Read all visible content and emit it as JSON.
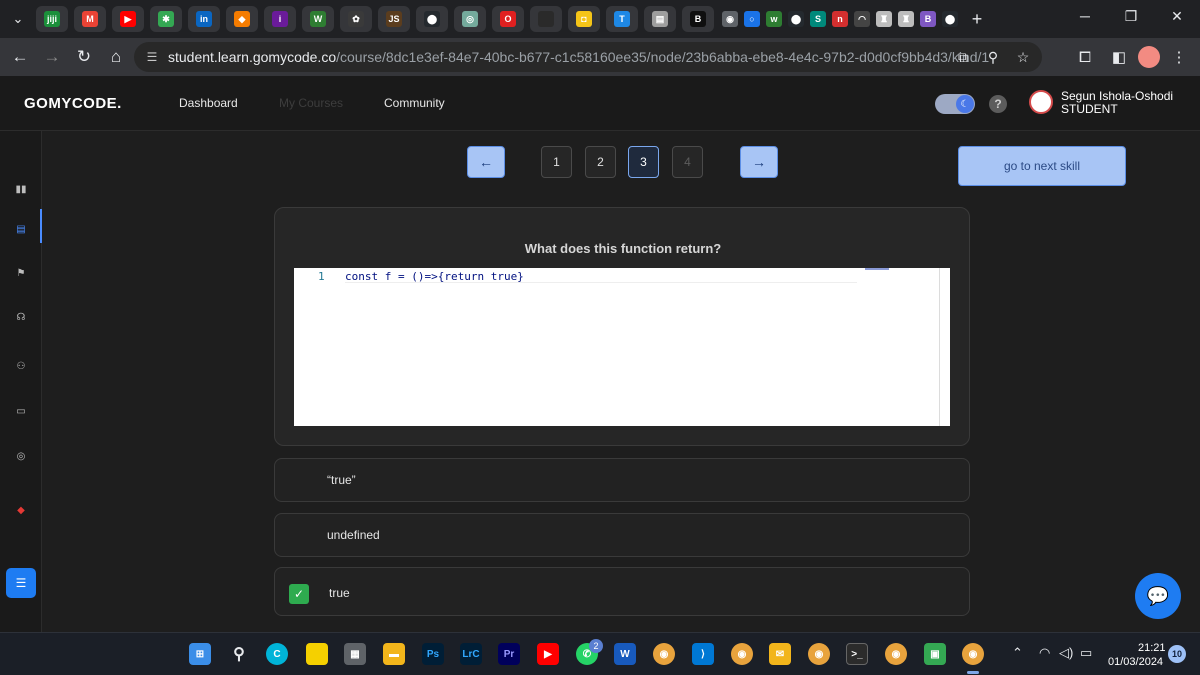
{
  "browser": {
    "tabs": [
      {
        "icon": "jiji-icon",
        "text": "jiji",
        "color": "#1b8f3a"
      },
      {
        "icon": "gmail-icon",
        "text": "M",
        "color": "#ea4335"
      },
      {
        "icon": "youtube-icon",
        "text": "▶",
        "color": "#ff0000"
      },
      {
        "icon": "pinwheel-icon",
        "text": "✱",
        "color": "#34a853"
      },
      {
        "icon": "linkedin-icon",
        "text": "in",
        "color": "#0a66c2"
      },
      {
        "icon": "flame-icon",
        "text": "◆",
        "color": "#f57c00"
      },
      {
        "icon": "info-circle-icon",
        "text": "i",
        "color": "#6a1b9a"
      },
      {
        "icon": "w-logo-icon",
        "text": "W",
        "color": "#2e7d32"
      },
      {
        "icon": "bug-icon",
        "text": "✿",
        "color": "#3a3a3a"
      },
      {
        "icon": "js-icon",
        "text": "JS",
        "color": "#5b3d1e"
      },
      {
        "icon": "github-icon",
        "text": "⬤",
        "color": "#24292e"
      },
      {
        "icon": "chatgpt-icon",
        "text": "◎",
        "color": "#74aa9c"
      },
      {
        "icon": "opera-icon",
        "text": "O",
        "color": "#e02020"
      },
      {
        "icon": "blank-tab-icon",
        "text": "",
        "color": "#2a2a2a"
      },
      {
        "icon": "yellow-app-icon",
        "text": "◘",
        "color": "#f5c518"
      },
      {
        "icon": "t-circle-icon",
        "text": "T",
        "color": "#1e88e5"
      },
      {
        "icon": "doc-icon",
        "text": "▤",
        "color": "#9e9e9e"
      },
      {
        "icon": "b-icon",
        "text": "B",
        "color": "#0f0f0f"
      }
    ],
    "compact_tabs": [
      {
        "icon": "globe-icon",
        "text": "◉",
        "color": "#5f6368"
      },
      {
        "icon": "ring-icon",
        "text": "○",
        "color": "#1a73e8"
      },
      {
        "icon": "w-icon",
        "text": "w",
        "color": "#2e7d32"
      },
      {
        "icon": "github-icon",
        "text": "⬤",
        "color": "#24292e"
      },
      {
        "icon": "s-icon",
        "text": "S",
        "color": "#00897b"
      },
      {
        "icon": "n-icon",
        "text": "n",
        "color": "#d32f2f"
      },
      {
        "icon": "loading-icon",
        "text": "◠",
        "color": "#444444"
      },
      {
        "icon": "chess-icon",
        "text": "♜",
        "color": "#bdbdbd"
      },
      {
        "icon": "chess-icon",
        "text": "♜",
        "color": "#bdbdbd"
      },
      {
        "icon": "b-purple-icon",
        "text": "B",
        "color": "#7e57c2"
      },
      {
        "icon": "github-icon",
        "text": "⬤",
        "color": "#24292e"
      }
    ],
    "url_host": "student.learn.gomycode.co",
    "url_path": "/course/8dc1e3ef-84e7-40bc-b677-c1c58160ee35/node/23b6abba-ebe8-4e4c-97b2-d0d0cf9bb4d3/kind/1"
  },
  "app": {
    "logo": "GOMYCODE.",
    "nav": {
      "dashboard": "Dashboard",
      "my_courses": "My Courses",
      "community": "Community"
    },
    "user": {
      "name": "Segun Ishola-Oshodi",
      "role": "STUDENT"
    },
    "help": "?",
    "theme_toggle": {
      "dark_mode": true
    }
  },
  "pager": {
    "prev": "←",
    "next": "→",
    "pages": [
      "1",
      "2",
      "3",
      "4"
    ],
    "current": "3",
    "next_skill": "go to next skill"
  },
  "question": {
    "title": "What does this function return?",
    "line_number": "1",
    "code": "const f = ()=>{return true}"
  },
  "options": [
    {
      "label": "“true”",
      "selected": false
    },
    {
      "label": "undefined",
      "selected": false
    },
    {
      "label": "true",
      "selected": true
    }
  ],
  "sidebar": {
    "items": [
      "stats-icon",
      "document-icon",
      "flag-icon",
      "workshop-icon",
      "community-icon",
      "laptop-icon",
      "target-icon",
      "ruby-icon"
    ]
  },
  "taskbar": {
    "time": "21:21",
    "date": "01/03/2024",
    "notifications": "10",
    "whatsapp_badge": "2"
  },
  "colors": {
    "accent": "#1e7cf2",
    "button_light": "#a8c5f5",
    "correct": "#2eab4f"
  }
}
